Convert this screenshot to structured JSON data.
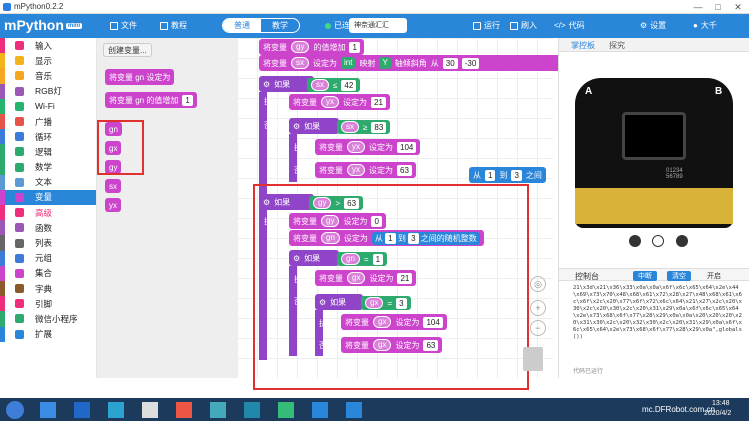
{
  "window": {
    "title": "mPython0.2.2"
  },
  "header": {
    "app_name": "mPython",
    "app_badge": "mini",
    "menu_file": "文件",
    "menu_tutorial": "教程",
    "mode_normal": "普通",
    "mode_teach": "教学",
    "status": "已连接",
    "device": "神奈通汇汇",
    "run": "运行",
    "flash": "刷入",
    "code": "代码",
    "settings": "设置",
    "user": "大千"
  },
  "categories": [
    {
      "label": "输入",
      "color": "#ee2e7a"
    },
    {
      "label": "显示",
      "color": "#f3b31b"
    },
    {
      "label": "音乐",
      "color": "#f5a623"
    },
    {
      "label": "RGB灯",
      "color": "#9b59b6"
    },
    {
      "label": "Wi-Fi",
      "color": "#25b36d"
    },
    {
      "label": "广播",
      "color": "#e6534b"
    },
    {
      "label": "循环",
      "color": "#3d7bd9"
    },
    {
      "label": "逻辑",
      "color": "#2faa6f"
    },
    {
      "label": "数学",
      "color": "#2faa6f"
    },
    {
      "label": "文本",
      "color": "#5a9bd5"
    },
    {
      "label": "变量",
      "color": "#cc44cc"
    },
    {
      "label": "高级",
      "color": "#ee2e7a"
    },
    {
      "label": "函数",
      "color": "#9b59b6"
    },
    {
      "label": "列表",
      "color": "#666"
    },
    {
      "label": "元组",
      "color": "#3d7bd9"
    },
    {
      "label": "集合",
      "color": "#cc44cc"
    },
    {
      "label": "字典",
      "color": "#8b5a2b"
    },
    {
      "label": "引脚",
      "color": "#ee2e7a"
    },
    {
      "label": "微信小程序",
      "color": "#2faa6f"
    },
    {
      "label": "扩展",
      "color": "#2a86d9"
    }
  ],
  "flyout": {
    "create_var": "创建变量...",
    "set_to": "将变量 gn 设定为",
    "increase": "将变量 gn 的值增加",
    "increase_val": "1",
    "vars": [
      "gn",
      "gx",
      "gy",
      "sx",
      "yx"
    ]
  },
  "code": {
    "b1": "将变量",
    "b1v": "gy",
    "b1b": "的值增加",
    "b1n": "1",
    "b2": "将变量",
    "b2v": "sx",
    "b2b": "设定为",
    "b2t": "int",
    "b2c": "映射",
    "b2d": "Y",
    "b2e": "轴倾斜角",
    "b2f": "从",
    "b2g": "30",
    "b2h": "-30",
    "if": "如果",
    "then": "执行",
    "else": "否则",
    "c1v": "sx",
    "c1o": "≤",
    "c1n": "42",
    "c1s": "yx",
    "c1sn": "21",
    "c2v": "sx",
    "c2o": "≥",
    "c2n": "83",
    "c2s": "yx",
    "c2sn": "104",
    "c2e": "63",
    "c3v": "gy",
    "c3o": ">",
    "c3n": "63",
    "c3a": "gy",
    "c3an": "0",
    "c3b": "gn",
    "c3rand": "从",
    "c3r1": "1",
    "c3to": "到",
    "c3r2": "3",
    "c3rt": "之间的随机整数",
    "c4v": "gn",
    "c4o": "=",
    "c4n": "1",
    "c4s": "gx",
    "c4sn": "21",
    "c5v": "gx",
    "c5o": "=",
    "c5n": "3",
    "c5s": "gx",
    "c5sn": "104",
    "c5e": "63",
    "randblk": "从 1 到 3 之间的"
  },
  "rightpanel": {
    "tab1": "掌控板",
    "tab2": "探究",
    "console": "控制台",
    "btn_mid": "中断",
    "btn_clr": "清空",
    "btn_sw": "开启",
    "logtext": "21\\x3d\\x21\\x36\\x33\\x0a\\x0a\\x6f\\x6c\\x65\\x64\\x2e\\x44\\x69\\x73\\x70\\x48\\x68\\x61\\x72\\x28\\x27\\x48\\x68\\x61\\x6c\\x6f\\x2c\\x20\\x77\\x6f\\x72\\x6c\\x64\\x21\\x27\\x2c\\x20\\x30\\x2c\\x20\\x30\\x2c\\x20\\x31\\x29\\x0a\\x6f\\x6c\\x65\\x64\\x2e\\x73\\x68\\x6f\\x77\\x28\\x29\\x0a\\x0a\\x20\\x20\\x20\\x20\\x31\\x30\\x2c\\x20\\x32\\x30\\x2c\\x20\\x31\\x29\\x0a\\x6f\\x6c\\x65\\x64\\x2e\\x73\\x68\\x6f\\x77\\x28\\x29\\x0a\",globals())",
    "hint": "代码已运行",
    "mark_a": "A",
    "mark_b": "B",
    "board_id": "01234 56789"
  },
  "taskbar": {
    "time": "13:48",
    "date": "2020/4/2",
    "tray": "mc.DFRobot.com.cn"
  }
}
